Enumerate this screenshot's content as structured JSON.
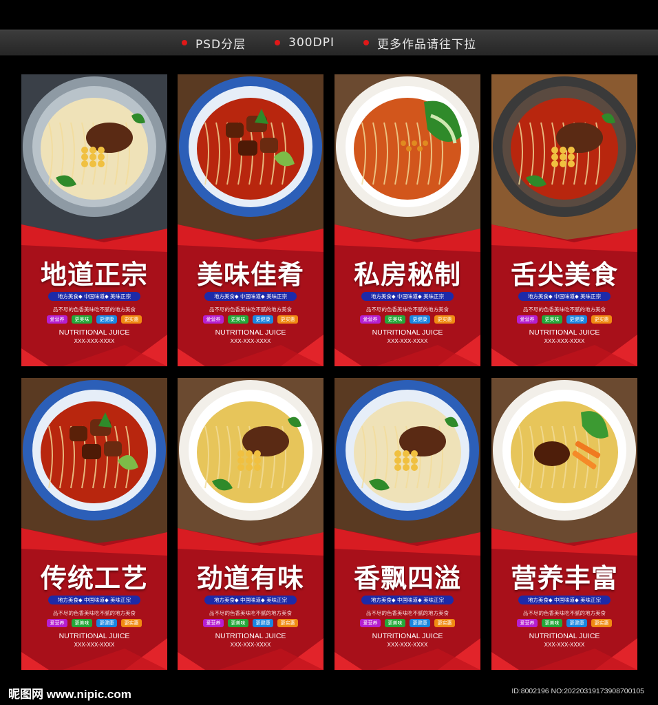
{
  "header": {
    "items": [
      "PSD分层",
      "300DPI",
      "更多作品请往下拉"
    ]
  },
  "cards": [
    {
      "title": "地道正宗",
      "subtitle": "地方美食◆ 中国味道◆ 美味正宗",
      "slogan": "品不尽的色香美味吃不腻的地方美食",
      "tags": [
        "爱营养",
        "更美味",
        "更健康",
        "更实惠"
      ],
      "english": "NUTRITIONAL JUICE",
      "phone": "XXX-XXX-XXXX",
      "bowl": "gray",
      "noodle": "cream",
      "topping": "beef-chickpea"
    },
    {
      "title": "美味佳肴",
      "subtitle": "地方美食◆ 中国味道◆ 美味正宗",
      "slogan": "品不尽的色香美味吃不腻的地方美食",
      "tags": [
        "爱营养",
        "更美味",
        "更健康",
        "更实惠"
      ],
      "english": "NUTRITIONAL JUICE",
      "phone": "XXX-XXX-XXXX",
      "bowl": "blue",
      "noodle": "red-broth",
      "topping": "braised-beef"
    },
    {
      "title": "私房秘制",
      "subtitle": "地方美食◆ 中国味道◆ 美味正宗",
      "slogan": "品不尽的色香美味吃不腻的地方美食",
      "tags": [
        "爱营养",
        "更美味",
        "更健康",
        "更实惠"
      ],
      "english": "NUTRITIONAL JUICE",
      "phone": "XXX-XXX-XXXX",
      "bowl": "white",
      "noodle": "chili-oil",
      "topping": "bok-choy"
    },
    {
      "title": "舌尖美食",
      "subtitle": "地方美食◆ 中国味道◆ 美味正宗",
      "slogan": "品不尽的色香美味吃不腻的地方美食",
      "tags": [
        "爱营养",
        "更美味",
        "更健康",
        "更实惠"
      ],
      "english": "NUTRITIONAL JUICE",
      "phone": "XXX-XXX-XXXX",
      "bowl": "dark",
      "noodle": "red-broth",
      "topping": "beef-chickpea"
    },
    {
      "title": "传统工艺",
      "subtitle": "地方美食◆ 中国味道◆ 美味正宗",
      "slogan": "品不尽的色香美味吃不腻的地方美食",
      "tags": [
        "爱营养",
        "更美味",
        "更健康",
        "更实惠"
      ],
      "english": "NUTRITIONAL JUICE",
      "phone": "XXX-XXX-XXXX",
      "bowl": "blue",
      "noodle": "red-broth",
      "topping": "braised-beef"
    },
    {
      "title": "劲道有味",
      "subtitle": "地方美食◆ 中国味道◆ 美味正宗",
      "slogan": "品不尽的色香美味吃不腻的地方美食",
      "tags": [
        "爱营养",
        "更美味",
        "更健康",
        "更实惠"
      ],
      "english": "NUTRITIONAL JUICE",
      "phone": "XXX-XXX-XXXX",
      "bowl": "white",
      "noodle": "yellow",
      "topping": "beef-chickpea"
    },
    {
      "title": "香飘四溢",
      "subtitle": "地方美食◆ 中国味道◆ 美味正宗",
      "slogan": "品不尽的色香美味吃不腻的地方美食",
      "tags": [
        "爱营养",
        "更美味",
        "更健康",
        "更实惠"
      ],
      "english": "NUTRITIONAL JUICE",
      "phone": "XXX-XXX-XXXX",
      "bowl": "blue",
      "noodle": "cream",
      "topping": "beef-chickpea"
    },
    {
      "title": "营养丰富",
      "subtitle": "地方美食◆ 中国味道◆ 美味正宗",
      "slogan": "品不尽的色香美味吃不腻的地方美食",
      "tags": [
        "爱营养",
        "更美味",
        "更健康",
        "更实惠"
      ],
      "english": "NUTRITIONAL JUICE",
      "phone": "XXX-XXX-XXXX",
      "bowl": "white",
      "noodle": "yellow",
      "topping": "carrot-choy"
    }
  ],
  "tag_colors": [
    "#b61fd0",
    "#25a83a",
    "#1a86e0",
    "#f08a12"
  ],
  "footer": {
    "logo": "昵图网 www.nipic.com",
    "id": "ID:8002196 NO:20220319173908700105"
  }
}
